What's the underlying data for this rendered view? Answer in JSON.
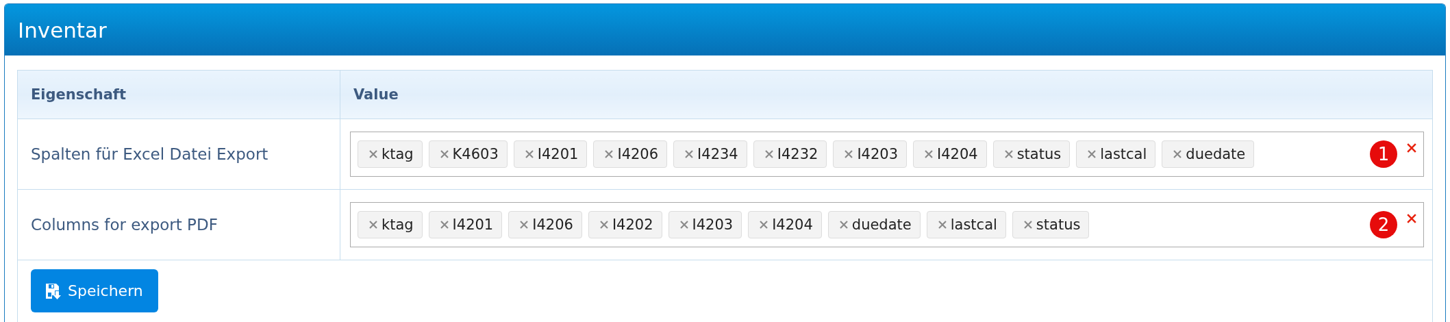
{
  "panel": {
    "title": "Inventar"
  },
  "table": {
    "columns": [
      "Eigenschaft",
      "Value"
    ],
    "rows": [
      {
        "label": "Spalten für Excel Datei Export",
        "tags": [
          "ktag",
          "K4603",
          "I4201",
          "I4206",
          "I4234",
          "I4232",
          "I4203",
          "I4204",
          "status",
          "lastcal",
          "duedate"
        ],
        "badge": "1"
      },
      {
        "label": "Columns for export PDF",
        "tags": [
          "ktag",
          "I4201",
          "I4206",
          "I4202",
          "I4203",
          "I4204",
          "duedate",
          "lastcal",
          "status"
        ],
        "badge": "2"
      }
    ]
  },
  "save_button": {
    "label": "Speichern"
  }
}
